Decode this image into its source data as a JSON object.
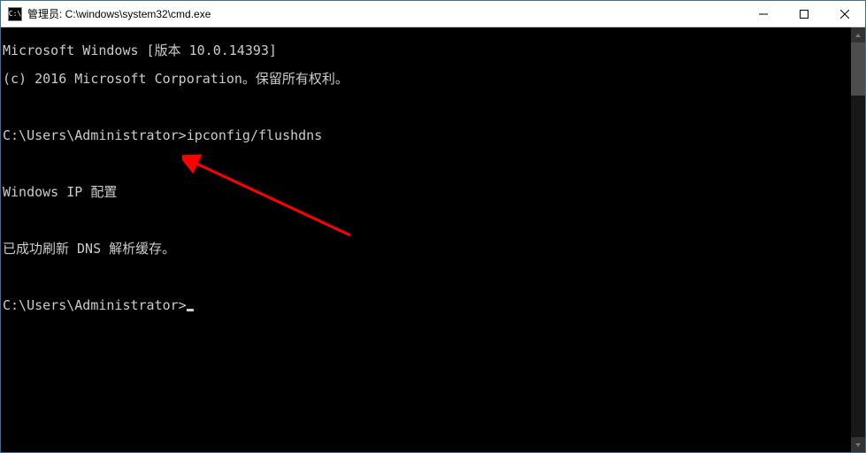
{
  "titlebar": {
    "icon_label": "C:\\",
    "title": "管理员: C:\\windows\\system32\\cmd.exe",
    "min_tip": "Minimize",
    "max_tip": "Maximize",
    "close_tip": "Close"
  },
  "console": {
    "line1": "Microsoft Windows [版本 10.0.14393]",
    "line2": "(c) 2016 Microsoft Corporation。保留所有权利。",
    "blank1": "",
    "prompt1_path": "C:\\Users\\Administrator>",
    "prompt1_cmd": "ipconfig/flushdns",
    "blank2": "",
    "line3": "Windows IP 配置",
    "blank3": "",
    "line4": "已成功刷新 DNS 解析缓存。",
    "blank4": "",
    "prompt2_path": "C:\\Users\\Administrator>"
  }
}
